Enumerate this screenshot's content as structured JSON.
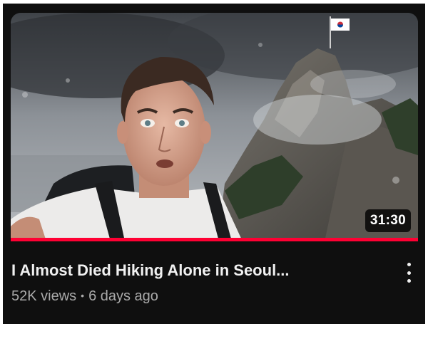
{
  "video": {
    "title": "I Almost Died Hiking Alone in Seoul...",
    "views": "52K views",
    "separator": "•",
    "age": "6 days ago",
    "duration": "31:30",
    "watched_fraction": 1.0
  },
  "icons": {
    "more": "more-vert-icon",
    "flag": "south-korea-flag-icon"
  },
  "colors": {
    "background": "#0f0f0f",
    "progress": "#ff0033",
    "title": "#f1f1f1",
    "meta": "#aaaaaa"
  }
}
